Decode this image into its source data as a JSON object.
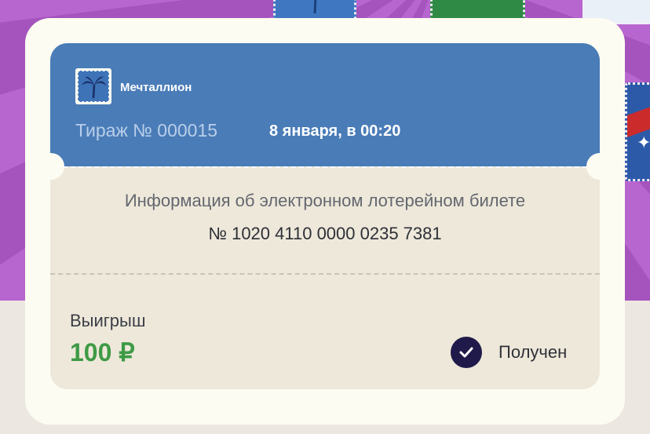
{
  "ticket": {
    "brand": "Мечталлион",
    "draw": "Тираж № 000015",
    "draw_date": "8 января, в 00:20",
    "info_title": "Информация об электронном лотерейном билете",
    "ticket_number": "№ 1020 4110 0000 0235 7381",
    "win_label": "Выигрыш",
    "win_amount": "100 ₽",
    "status": "Получен"
  },
  "icons": {
    "logo": "palm-tree-icon",
    "status": "checkmark-icon"
  },
  "colors": {
    "header": "#4a7cb8",
    "ticket_body": "#eee8da",
    "win_amount": "#3e9a45",
    "check_badge": "#1f1a4a",
    "background": "#b866cf"
  }
}
